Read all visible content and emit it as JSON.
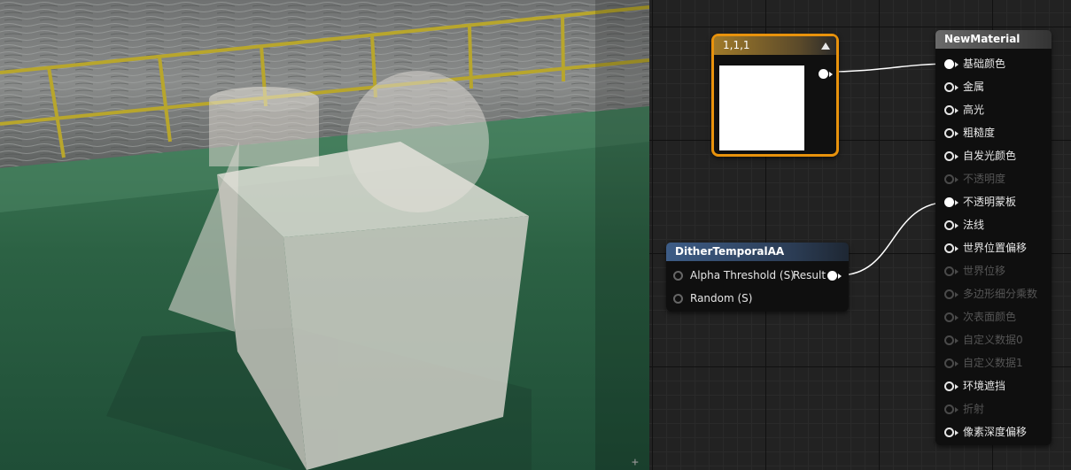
{
  "viewport": {
    "plus_glyph": "+"
  },
  "graph": {
    "constant_node": {
      "title": "1,1,1",
      "color": "#ffffff"
    },
    "dither_node": {
      "title": "DitherTemporalAA",
      "inputs": [
        "Alpha Threshold (S)",
        "Random (S)"
      ],
      "output": "Result"
    },
    "material_node": {
      "title": "NewMaterial",
      "pins": [
        {
          "label": "基础颜色",
          "state": "connected"
        },
        {
          "label": "金属",
          "state": "enabled"
        },
        {
          "label": "高光",
          "state": "enabled"
        },
        {
          "label": "粗糙度",
          "state": "enabled"
        },
        {
          "label": "自发光颜色",
          "state": "enabled"
        },
        {
          "label": "不透明度",
          "state": "disabled"
        },
        {
          "label": "不透明蒙板",
          "state": "connected"
        },
        {
          "label": "法线",
          "state": "enabled"
        },
        {
          "label": "世界位置偏移",
          "state": "enabled"
        },
        {
          "label": "世界位移",
          "state": "disabled"
        },
        {
          "label": "多边形细分乘数",
          "state": "disabled"
        },
        {
          "label": "次表面颜色",
          "state": "disabled"
        },
        {
          "label": "自定义数据0",
          "state": "disabled"
        },
        {
          "label": "自定义数据1",
          "state": "disabled"
        },
        {
          "label": "环境遮挡",
          "state": "enabled"
        },
        {
          "label": "折射",
          "state": "disabled"
        },
        {
          "label": "像素深度偏移",
          "state": "enabled"
        }
      ]
    },
    "colors": {
      "selection_border": "#e8920c",
      "wire": "#ffffff"
    }
  }
}
